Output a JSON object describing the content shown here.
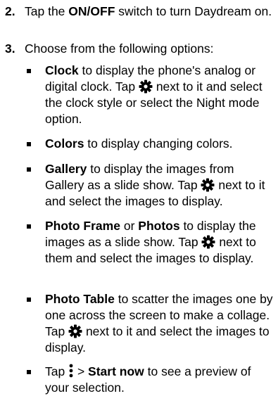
{
  "steps": [
    {
      "num": "2.",
      "pre": "Tap the ",
      "bold": "ON/OFF",
      "post": " switch to turn Daydream on."
    },
    {
      "num": "3.",
      "text": "Choose from the following options:"
    }
  ],
  "options": {
    "clock": {
      "name": "Clock",
      "a": " to display the phone's analog or digital clock. Tap ",
      "b": " next to it and select the clock style or select the Night mode option."
    },
    "colors": {
      "name": "Colors",
      "a": " to display changing colors."
    },
    "gallery": {
      "name": "Gallery",
      "a": " to display the images from Gallery as a slide show. Tap ",
      "b": " next to it and select the images to display."
    },
    "photo": {
      "name": "Photo Frame",
      "or": " or ",
      "name2": "Photos",
      "a": " to display the images as a slide show. Tap ",
      "b": " next to them and select the images to display."
    },
    "table": {
      "name": "Photo Table",
      "a": " to scatter the images one by one across the screen to make a collage. Tap ",
      "b": " next to it and select the images to display."
    },
    "preview": {
      "tap": "Tap ",
      "sep": " > ",
      "name": "Start now",
      "a": " to see a preview of your selection."
    }
  },
  "icons": {
    "settings": "gear-icon",
    "menu": "more-vert-icon"
  }
}
